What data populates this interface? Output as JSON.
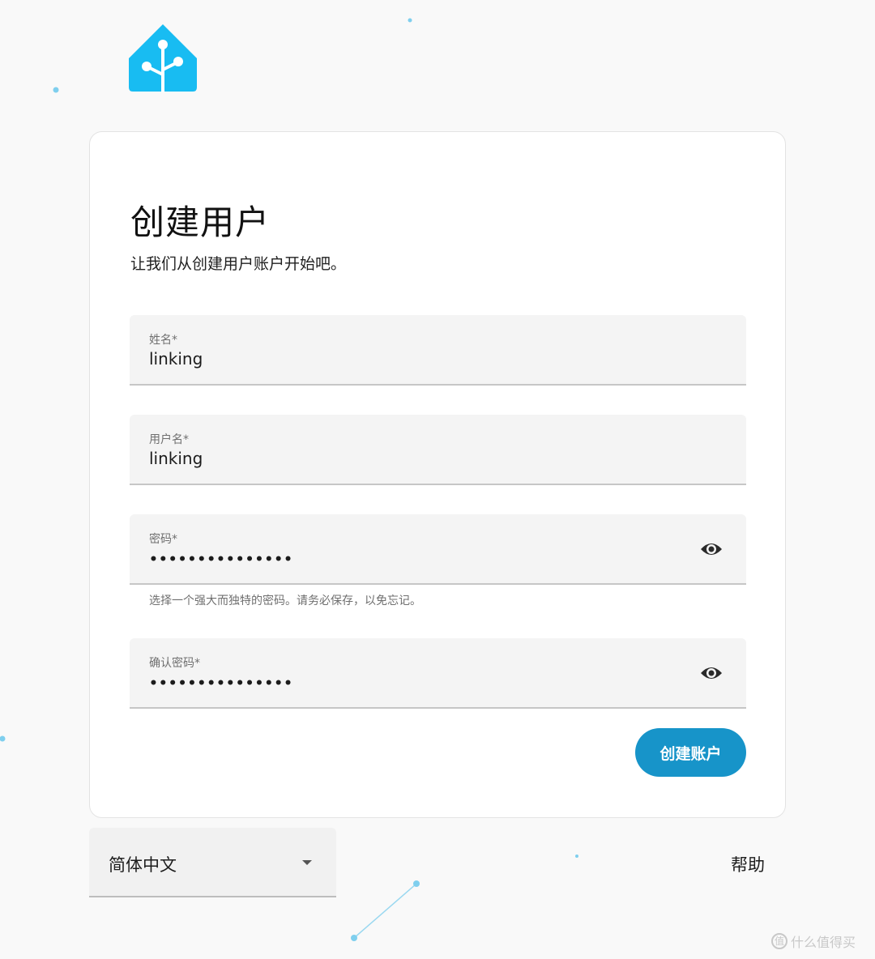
{
  "colors": {
    "brand": "#18bcf2",
    "primary_button": "#1794c9",
    "decoration": "#7fcfee"
  },
  "logo": {
    "icon": "home-assistant-logo"
  },
  "card": {
    "title": "创建用户",
    "subtitle": "让我们从创建用户账户开始吧。",
    "fields": {
      "name": {
        "label": "姓名*",
        "value": "linking"
      },
      "username": {
        "label": "用户名*",
        "value": "linking"
      },
      "password": {
        "label": "密码*",
        "value": "•••••••••••••••",
        "icon": "eye-icon",
        "helper": "选择一个强大而独特的密码。请务必保存，以免忘记。"
      },
      "confirm_password": {
        "label": "确认密码*",
        "value": "•••••••••••••••",
        "icon": "eye-icon"
      }
    },
    "submit_label": "创建账户"
  },
  "footer": {
    "language": {
      "value": "简体中文",
      "icon": "chevron-down-icon"
    },
    "help_label": "帮助"
  },
  "watermark": {
    "text": "什么值得买",
    "icon": "zhi-icon",
    "icon_glyph": "值"
  }
}
